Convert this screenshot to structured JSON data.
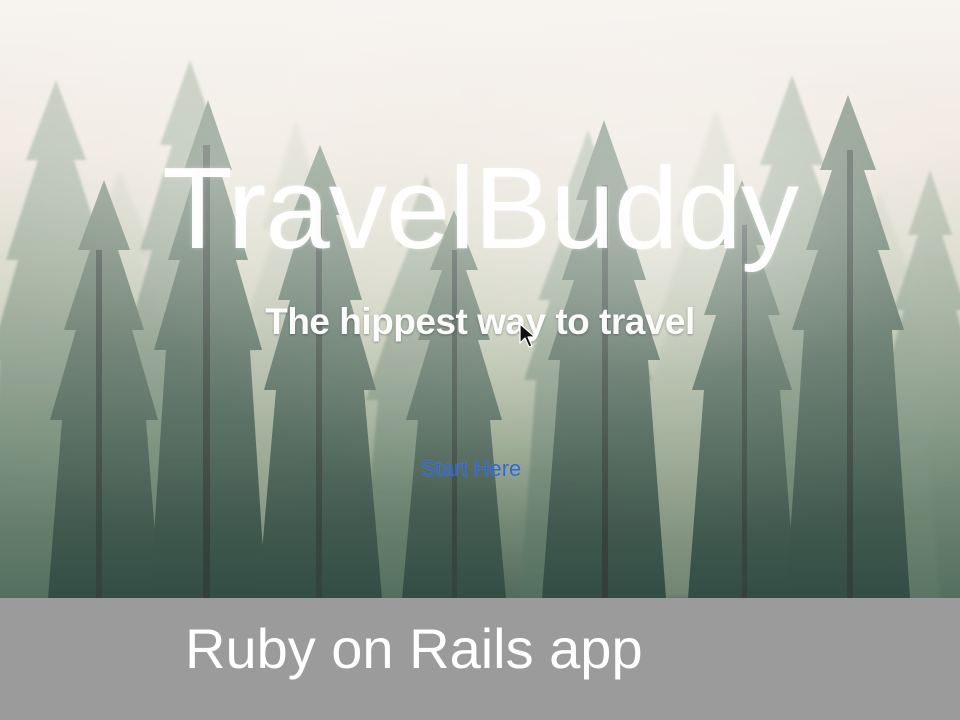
{
  "hero": {
    "title": "TravelBuddy",
    "subtitle": "The hippest way to travel",
    "cta_label": "Start Here"
  },
  "caption": {
    "text": "Ruby on Rails app"
  },
  "colors": {
    "cta": "#2d66d8",
    "caption_background": "#9b9b9b",
    "hero_text": "#ffffff"
  },
  "icons": {
    "pointer": "mouse-pointer-icon"
  }
}
